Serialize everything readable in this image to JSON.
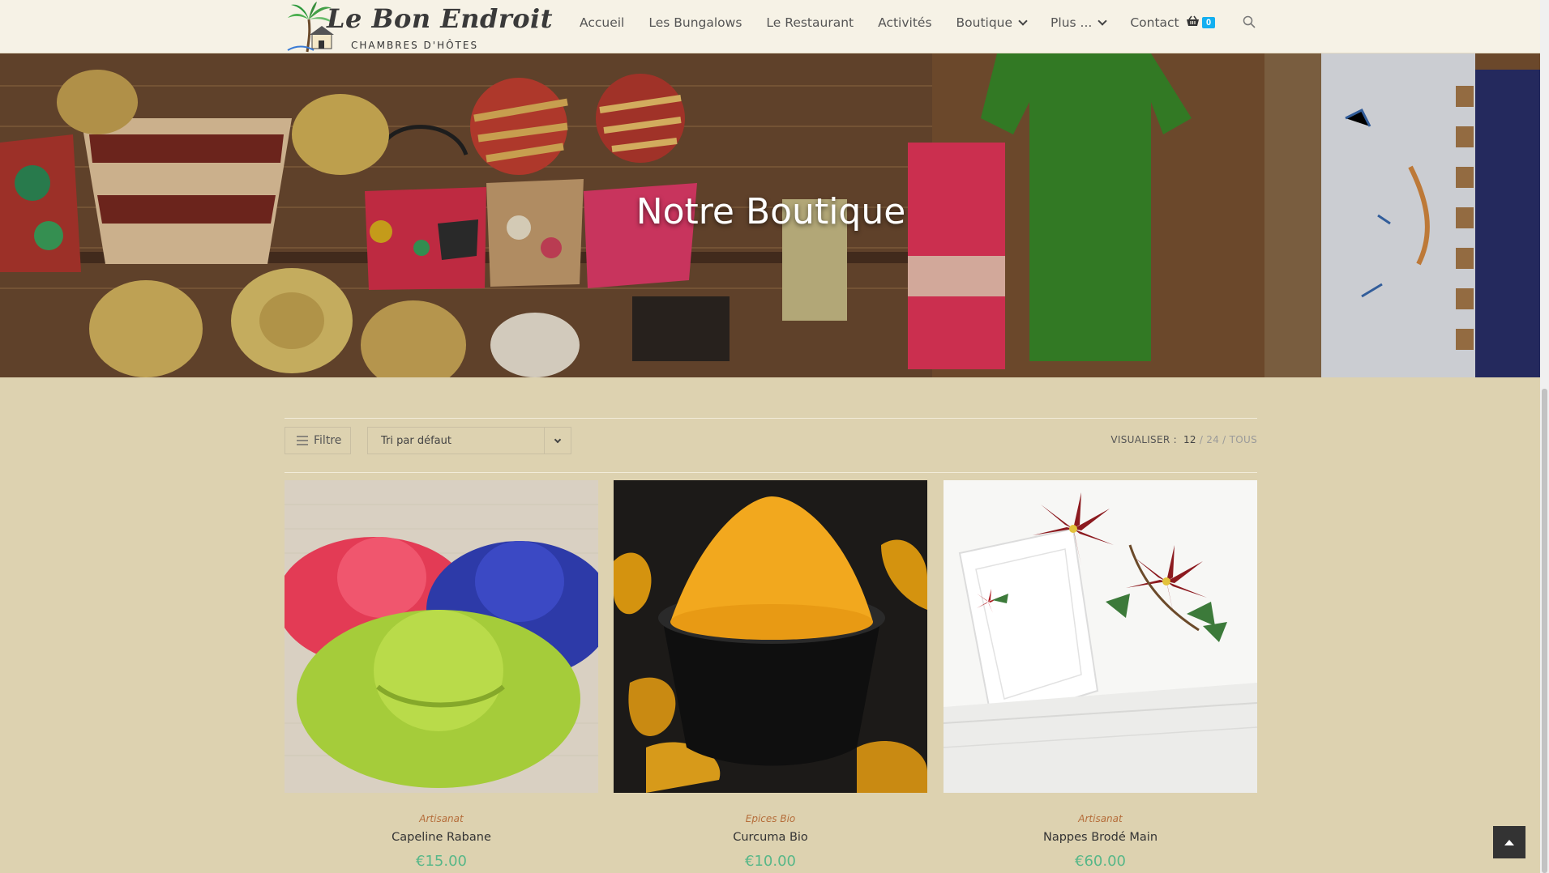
{
  "site": {
    "logo_title": "Le Bon Endroit",
    "logo_subtitle": "CHAMBRES D'HÔTES"
  },
  "nav": {
    "items": [
      {
        "label": "Accueil"
      },
      {
        "label": "Les Bungalows"
      },
      {
        "label": "Le Restaurant"
      },
      {
        "label": "Activités"
      },
      {
        "label": "Boutique"
      },
      {
        "label": "Plus ..."
      },
      {
        "label": "Contact"
      }
    ],
    "cart_count": "0",
    "icons": [
      "basket-icon",
      "search-icon",
      "chevron-down-icon"
    ]
  },
  "hero": {
    "title": "Notre Boutique"
  },
  "toolbar": {
    "filter_label": "Filtre",
    "sort_value": "Tri par défaut",
    "view_label": "VISUALISER :",
    "view_options": [
      "12",
      "/ 24",
      "/ TOUS"
    ]
  },
  "products": [
    {
      "category": "Artisanat",
      "name": "Capeline Rabane",
      "price": "€15.00"
    },
    {
      "category": "Epices Bio",
      "name": "Curcuma Bio",
      "price": "€10.00"
    },
    {
      "category": "Artisanat",
      "name": "Nappes Brodé Main",
      "price": "€60.00"
    }
  ],
  "colors": {
    "page_bg": "#ddd2b0",
    "header_bg": "#f6f2e6",
    "accent_badge": "#13aff0",
    "price": "#57b788",
    "category": "#b56d3a"
  }
}
